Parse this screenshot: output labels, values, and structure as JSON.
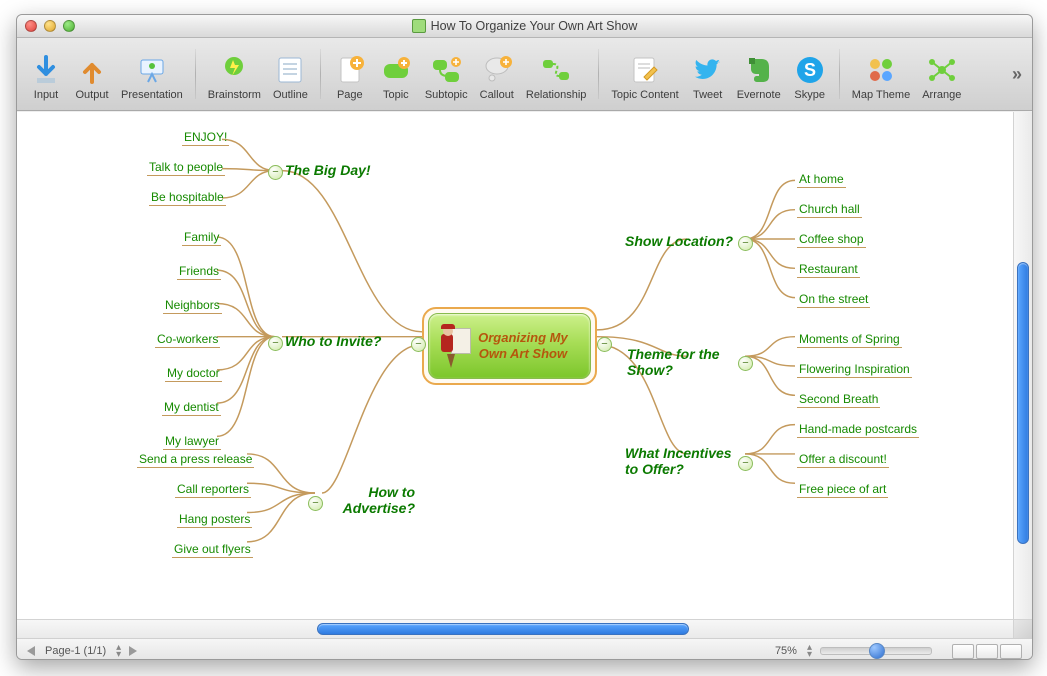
{
  "window": {
    "title": "How To Organize Your Own Art Show"
  },
  "toolbar": {
    "items": [
      {
        "label": "Input"
      },
      {
        "label": "Output"
      },
      {
        "label": "Presentation"
      },
      {
        "sep": true
      },
      {
        "label": "Brainstorm"
      },
      {
        "label": "Outline"
      },
      {
        "sep": true
      },
      {
        "label": "Page"
      },
      {
        "label": "Topic"
      },
      {
        "label": "Subtopic"
      },
      {
        "label": "Callout"
      },
      {
        "label": "Relationship"
      },
      {
        "sep": true
      },
      {
        "label": "Topic Content"
      },
      {
        "label": "Tweet"
      },
      {
        "label": "Evernote"
      },
      {
        "label": "Skype"
      },
      {
        "sep": true
      },
      {
        "label": "Map Theme"
      },
      {
        "label": "Arrange"
      }
    ]
  },
  "status": {
    "page_label": "Page-1 (1/1)",
    "zoom": "75%"
  },
  "mindmap": {
    "central": "Organizing My Own Art Show",
    "left_branches": [
      {
        "title": "The Big Day!",
        "children": [
          "ENJOY!",
          "Talk to people",
          "Be hospitable"
        ]
      },
      {
        "title": "Who to Invite?",
        "children": [
          "Family",
          "Friends",
          "Neighbors",
          "Co-workers",
          "My doctor",
          "My dentist",
          "My lawyer"
        ]
      },
      {
        "title": "How to Advertise?",
        "children": [
          "Send a press release",
          "Call reporters",
          "Hang posters",
          "Give out flyers"
        ]
      }
    ],
    "right_branches": [
      {
        "title": "Show Location?",
        "children": [
          "At home",
          "Church hall",
          "Coffee shop",
          "Restaurant",
          "On the street"
        ]
      },
      {
        "title": "Theme for the Show?",
        "children": [
          "Moments of Spring",
          "Flowering Inspiration",
          "Second Breath"
        ]
      },
      {
        "title": "What Incentives to Offer?",
        "children": [
          "Hand-made postcards",
          "Offer a discount!",
          "Free piece of art"
        ]
      }
    ]
  }
}
